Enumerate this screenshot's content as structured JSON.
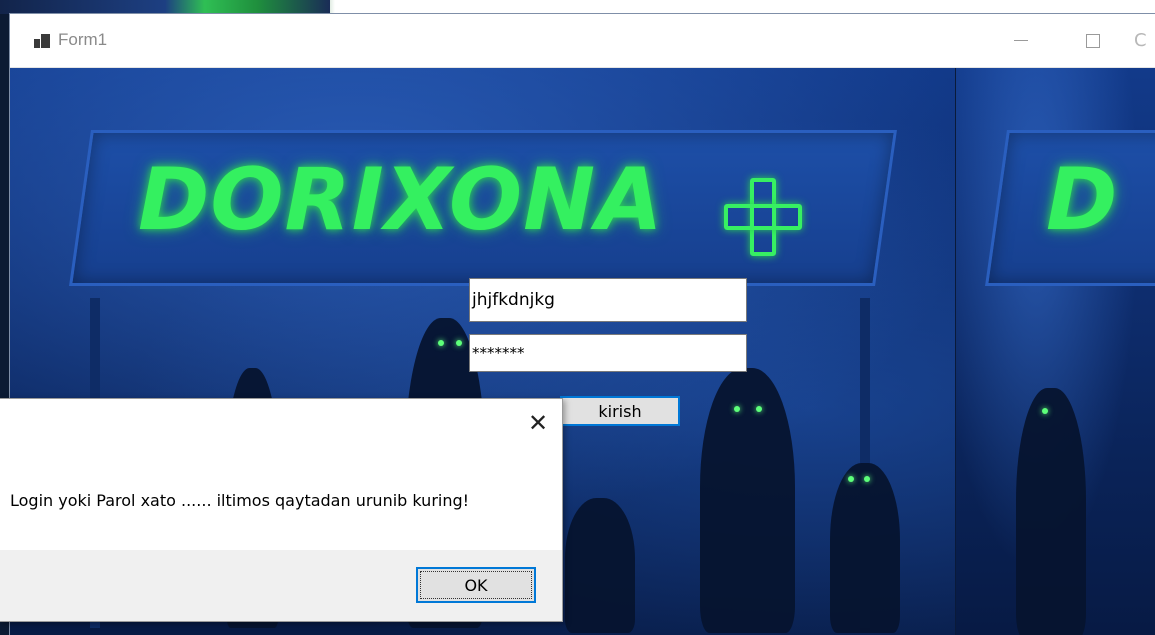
{
  "window": {
    "title": "Form1",
    "icon": "app-form-icon",
    "controls": {
      "minimize": "—",
      "maximize": "☐",
      "close": "✕"
    }
  },
  "scene": {
    "sign_text": "DORIXONA",
    "sign_text_partial": "D",
    "sign_icon": "plus-cross-icon",
    "accent_color": "#34f060",
    "background_color": "#0e2d6e"
  },
  "form": {
    "login_value": "jhjfkdnjkg",
    "password_value": "*******",
    "submit_label": "kirish"
  },
  "message_box": {
    "close_glyph": "✕",
    "message": "Login yoki Parol xato ...... iltimos qaytadan urunib kuring!",
    "ok_label": "OK"
  }
}
